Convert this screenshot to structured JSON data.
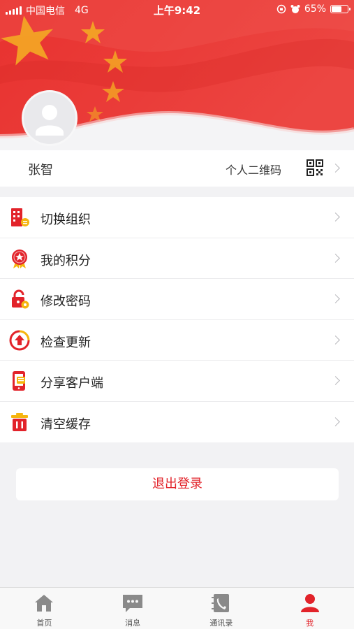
{
  "status_bar": {
    "carrier": "中国电信",
    "network": "4G",
    "time": "上午9:42",
    "battery": "65%",
    "battery_level": 0.65
  },
  "profile": {
    "name": "张智",
    "qr_label": "个人二维码"
  },
  "menu": {
    "items": [
      {
        "label": "切换组织",
        "icon": "building-icon"
      },
      {
        "label": "我的积分",
        "icon": "medal-icon"
      },
      {
        "label": "修改密码",
        "icon": "lock-icon"
      },
      {
        "label": "检查更新",
        "icon": "update-icon"
      },
      {
        "label": "分享客户端",
        "icon": "share-phone-icon"
      },
      {
        "label": "清空缓存",
        "icon": "trash-icon"
      }
    ]
  },
  "logout": {
    "label": "退出登录"
  },
  "tabbar": {
    "items": [
      {
        "label": "首页",
        "icon": "home-icon",
        "active": false
      },
      {
        "label": "消息",
        "icon": "message-icon",
        "active": false
      },
      {
        "label": "通讯录",
        "icon": "contacts-icon",
        "active": false
      },
      {
        "label": "我",
        "icon": "person-icon",
        "active": true
      }
    ]
  },
  "colors": {
    "accent": "#e2232a",
    "banner_red": "#e53a36",
    "icon_yellow": "#f5b50f"
  }
}
